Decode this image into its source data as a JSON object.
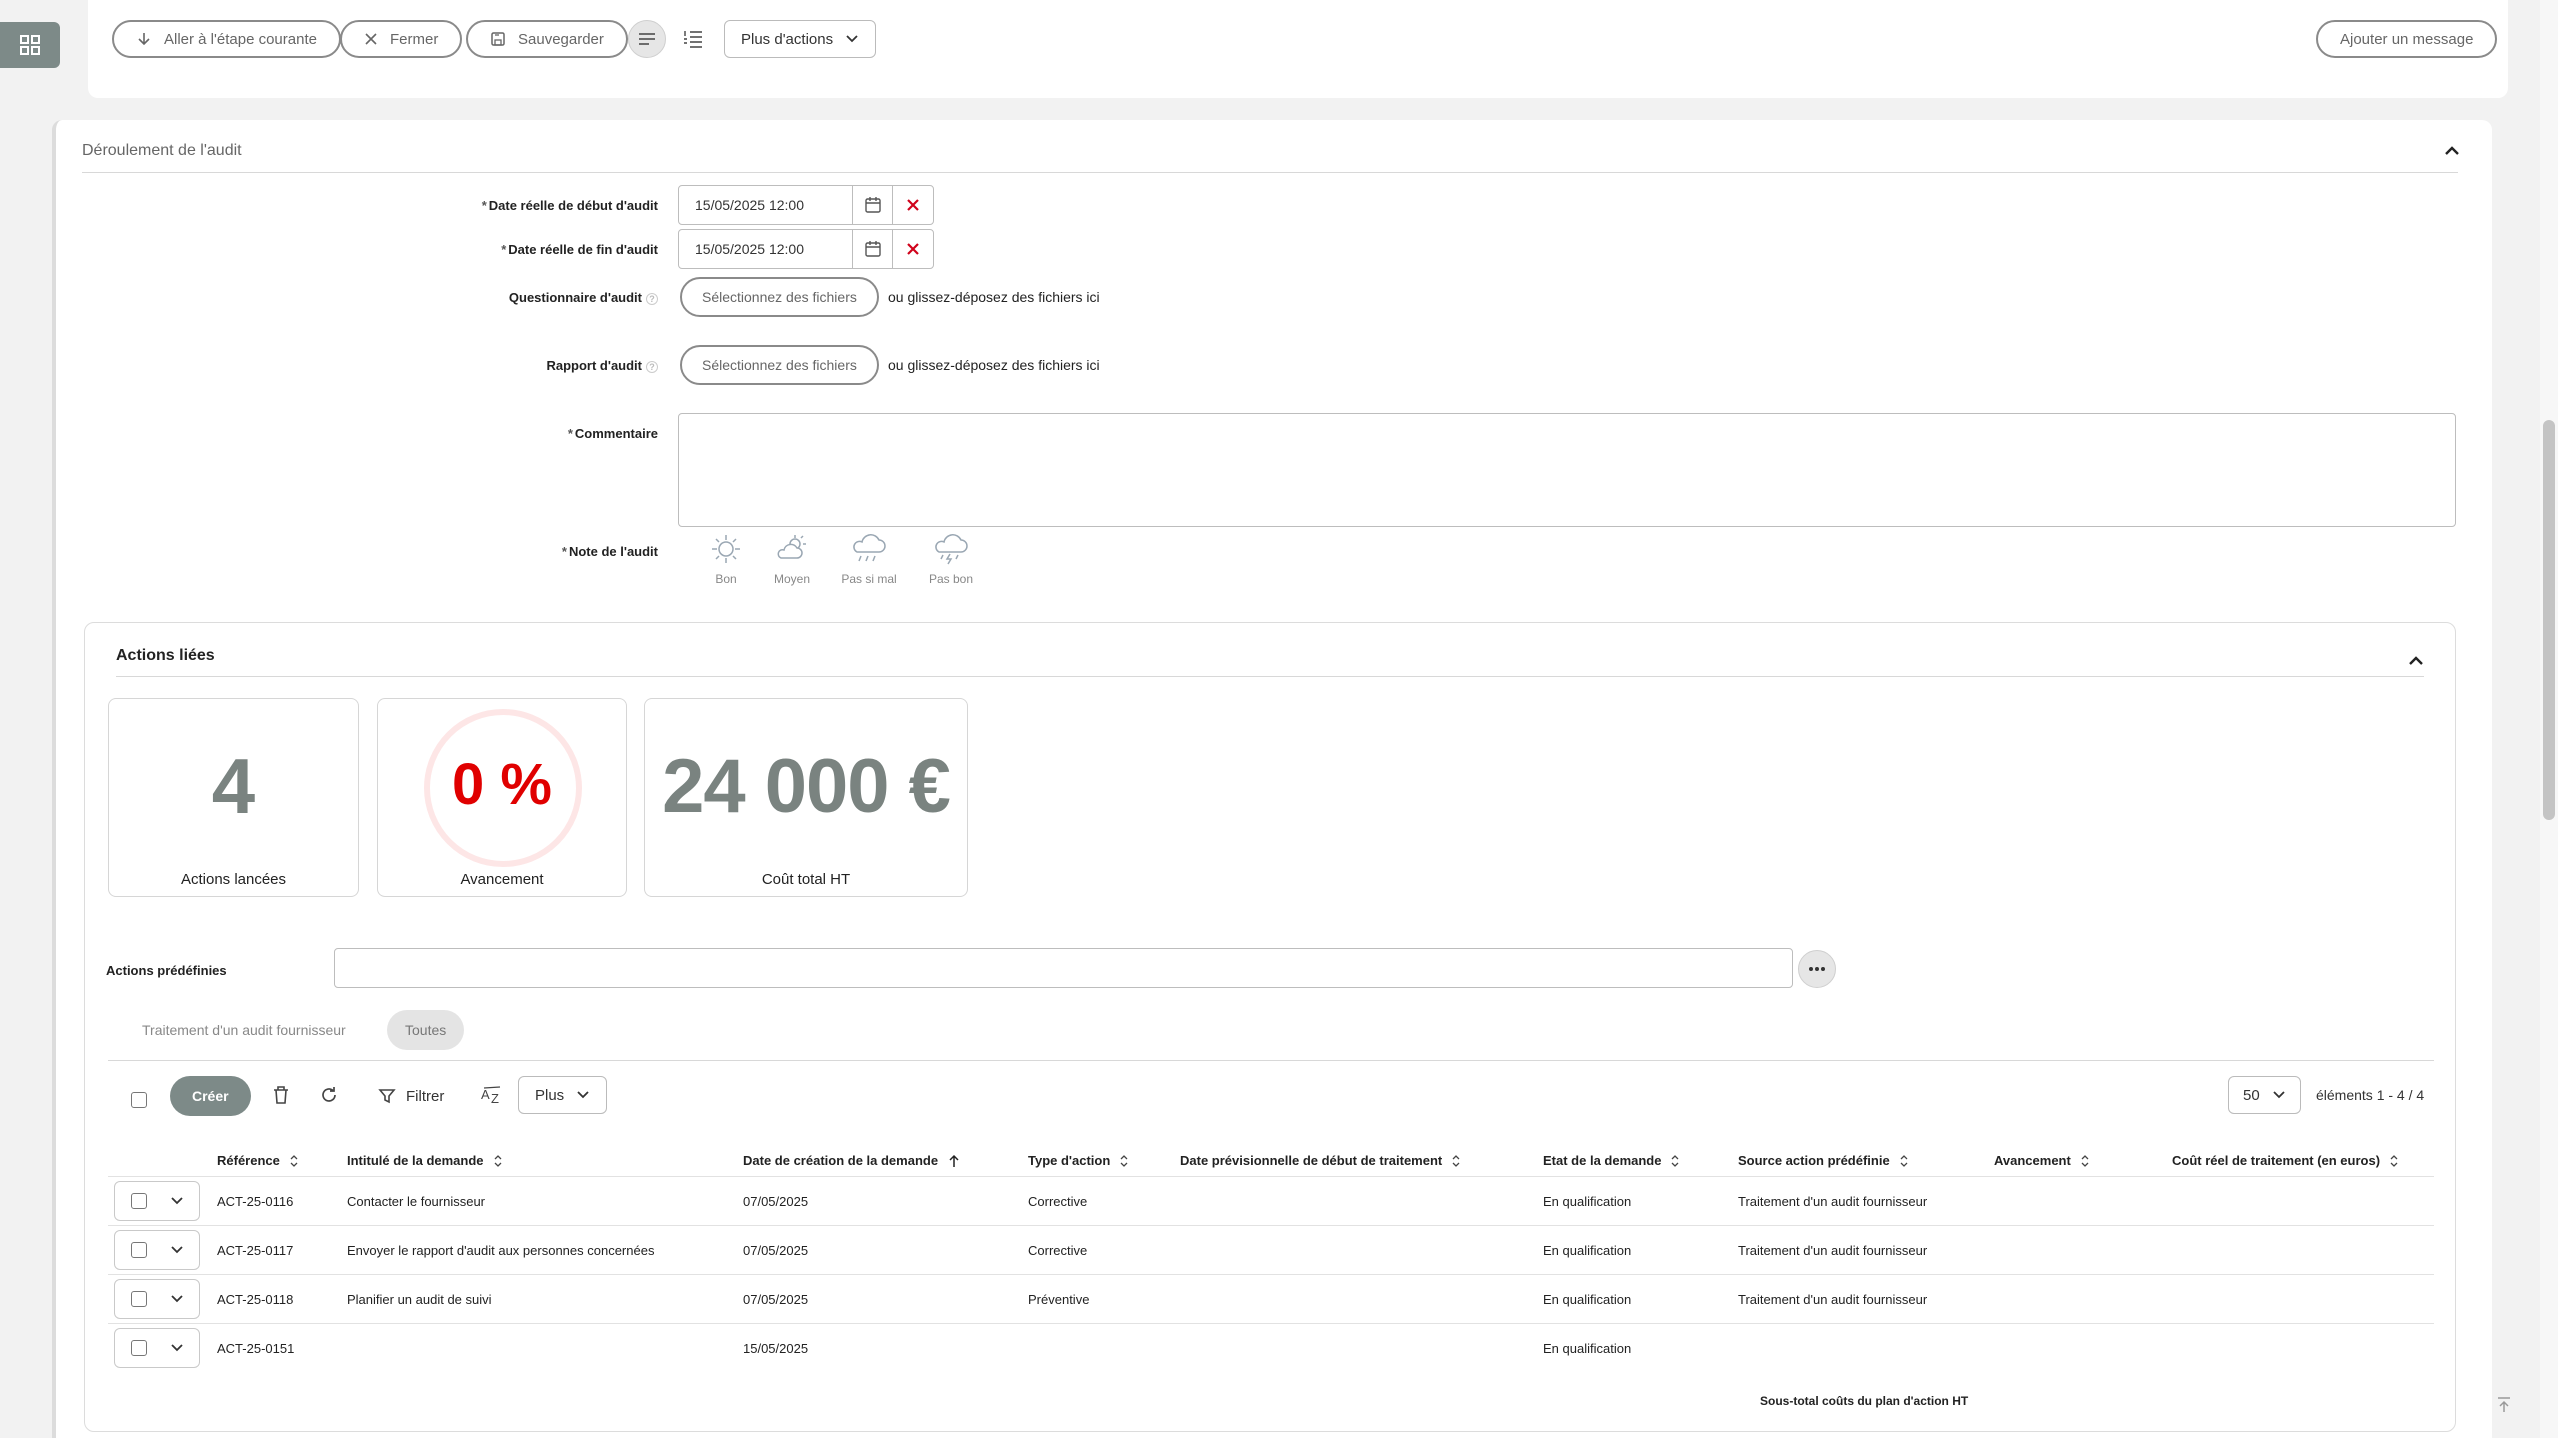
{
  "toolbar": {
    "goto_step": "Aller à l'étape courante",
    "close": "Fermer",
    "save": "Sauvegarder",
    "more_actions": "Plus d'actions",
    "add_message": "Ajouter un message"
  },
  "audit": {
    "section_title": "Déroulement de l'audit",
    "start_label": "Date réelle de début d'audit",
    "start_value": "15/05/2025 12:00",
    "end_label": "Date réelle de fin d'audit",
    "end_value": "15/05/2025 12:00",
    "questionnaire_label": "Questionnaire d'audit",
    "report_label": "Rapport d'audit",
    "select_files": "Sélectionnez des fichiers",
    "drop_hint": "ou glissez-déposez des fichiers ici",
    "comment_label": "Commentaire",
    "comment_value": "",
    "note_label": "Note de l'audit",
    "ratings": [
      "Bon",
      "Moyen",
      "Pas si mal",
      "Pas bon"
    ]
  },
  "actions": {
    "section_title": "Actions liées",
    "kpis": {
      "launched_value": "4",
      "launched_label": "Actions lancées",
      "progress_value": "0 %",
      "progress_fraction": 0,
      "progress_label": "Avancement",
      "cost_value": "24 000 €",
      "cost_label": "Coût total HT"
    },
    "predefined_label": "Actions prédéfinies",
    "predefined_value": "",
    "tabs": [
      "Traitement d'un audit fournisseur",
      "Toutes"
    ],
    "create": "Créer",
    "filter": "Filtrer",
    "plus": "Plus",
    "page_size": "50",
    "count": "éléments 1 - 4 / 4",
    "columns": [
      "Référence",
      "Intitulé de la demande",
      "Date de création de la demande",
      "Type d'action",
      "Date prévisionnelle de début de traitement",
      "Etat de la demande",
      "Source action prédéfinie",
      "Avancement",
      "Coût réel de traitement (en euros)"
    ],
    "rows": [
      [
        "ACT-25-0116",
        "Contacter le fournisseur",
        "07/05/2025",
        "Corrective",
        "",
        "En qualification",
        "Traitement d'un audit fournisseur",
        "",
        ""
      ],
      [
        "ACT-25-0117",
        "Envoyer le rapport d'audit aux personnes concernées",
        "07/05/2025",
        "Corrective",
        "",
        "En qualification",
        "Traitement d'un audit fournisseur",
        "",
        ""
      ],
      [
        "ACT-25-0118",
        "Planifier un audit de suivi",
        "07/05/2025",
        "Préventive",
        "",
        "En qualification",
        "Traitement d'un audit fournisseur",
        "",
        ""
      ],
      [
        "ACT-25-0151",
        "",
        "15/05/2025",
        "",
        "",
        "En qualification",
        "",
        "",
        ""
      ]
    ],
    "subtotal": "Sous-total coûts du plan d'action HT"
  }
}
